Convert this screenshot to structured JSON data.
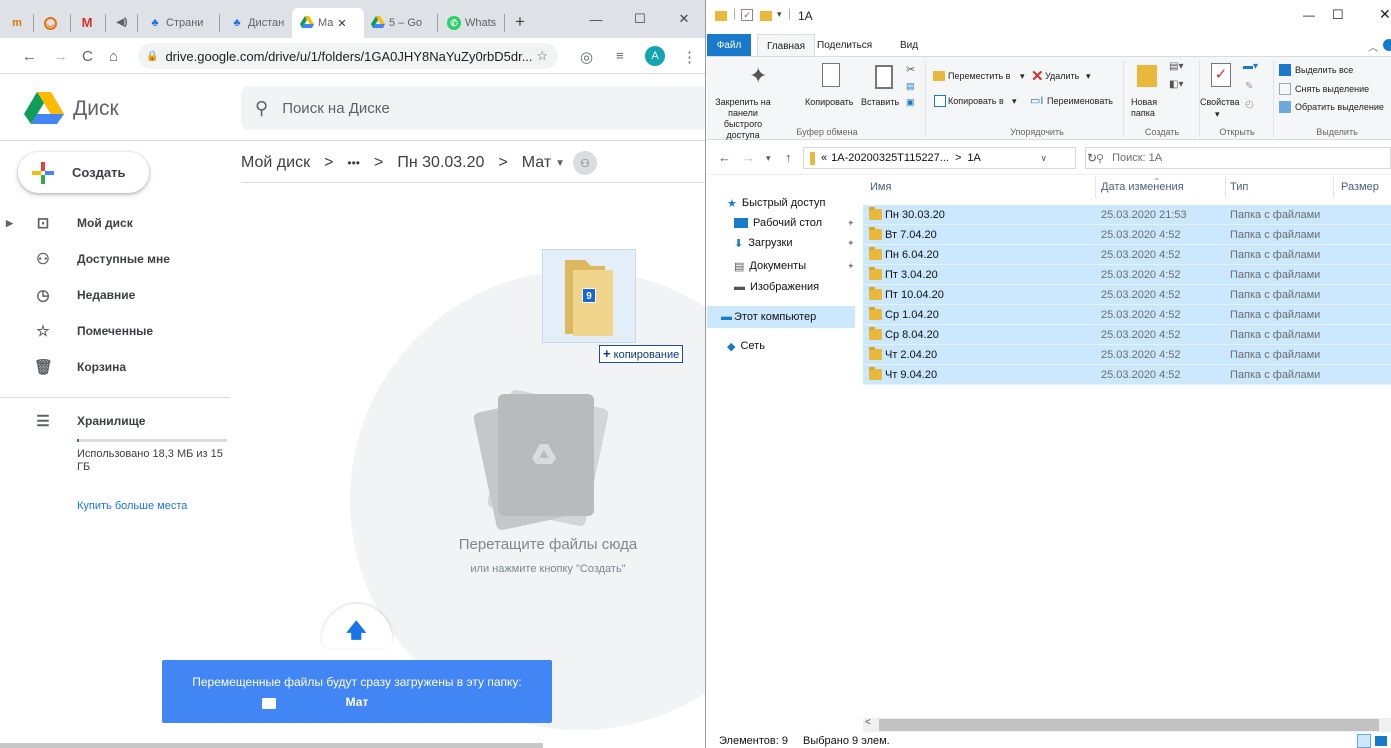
{
  "chrome": {
    "tabs": [
      {
        "label": "",
        "icon": "tm-logo-icon"
      },
      {
        "label": "",
        "icon": "mail-ru-icon"
      },
      {
        "label": "",
        "icon": "gmail-icon"
      },
      {
        "label": "",
        "icon": "speaker-icon"
      },
      {
        "label": "Страни",
        "icon": "contacts-icon"
      },
      {
        "label": "Дистан",
        "icon": "contacts-icon"
      },
      {
        "label": "Ма",
        "icon": "drive-icon",
        "active": true
      },
      {
        "label": "5 – Go",
        "icon": "drive-icon"
      },
      {
        "label": "Whats",
        "icon": "whatsapp-icon"
      }
    ],
    "url": "drive.google.com/drive/u/1/folders/1GA0JHY8NaYuZy0rbD5dr...",
    "profile_initial": "A"
  },
  "drive": {
    "title": "Диск",
    "search_placeholder": "Поиск на Диске",
    "create_label": "Создать",
    "nav": [
      {
        "label": "Мой диск",
        "icon": "my-drive-icon"
      },
      {
        "label": "Доступные мне",
        "icon": "shared-icon"
      },
      {
        "label": "Недавние",
        "icon": "clock-icon"
      },
      {
        "label": "Помеченные",
        "icon": "star-icon"
      },
      {
        "label": "Корзина",
        "icon": "trash-icon"
      }
    ],
    "storage_label": "Хранилище",
    "storage_used": "Использовано 18,3 МБ из 15 ГБ",
    "storage_fraction": 0.0012,
    "buy_more": "Купить больше места",
    "breadcrumb": {
      "root": "Мой диск",
      "sep": ">",
      "ellipsis": "•••",
      "folder1": "Пн 30.03.20",
      "current": "Мат"
    },
    "drop_title": "Перетащите файлы сюда",
    "drop_subtitle": "или нажмите кнопку \"Создать\"",
    "banner_text": "Перемещенные файлы будут сразу загружены в эту папку:",
    "banner_folder": "Мат",
    "drag_count": "9",
    "drag_tooltip": "копирование"
  },
  "explorer": {
    "title": "1А",
    "ribbon_tabs": {
      "file": "Файл",
      "home": "Главная",
      "share": "Поделиться",
      "view": "Вид"
    },
    "ribbon": {
      "pin": "Закрепить на панели быстрого доступа",
      "copy": "Копировать",
      "paste": "Вставить",
      "clipboard_group": "Буфер обмена",
      "move_to": "Переместить в",
      "copy_to": "Копировать в",
      "delete": "Удалить",
      "rename": "Переименовать",
      "organize_group": "Упорядочить",
      "new_folder": "Новая папка",
      "create_group": "Создать",
      "properties": "Свойства",
      "open_group": "Открыть",
      "select_all": "Выделить все",
      "select_none": "Снять выделение",
      "invert_selection": "Обратить выделение",
      "select_group": "Выделить"
    },
    "path_parts": {
      "prefix": "«",
      "parent": "1А-20200325T115227...",
      "sep": ">",
      "current": "1А"
    },
    "search_placeholder": "Поиск: 1А",
    "nav": {
      "quick_access": "Быстрый доступ",
      "desktop": "Рабочий стол",
      "downloads": "Загрузки",
      "documents": "Документы",
      "images": "Изображения",
      "this_pc": "Этот компьютер",
      "network": "Сеть"
    },
    "columns": {
      "name": "Имя",
      "date": "Дата изменения",
      "type": "Тип",
      "size": "Размер"
    },
    "files": [
      {
        "name": "Пн 30.03.20",
        "date": "25.03.2020 21:53",
        "type": "Папка с файлами"
      },
      {
        "name": "Вт 7.04.20",
        "date": "25.03.2020 4:52",
        "type": "Папка с файлами"
      },
      {
        "name": "Пн 6.04.20",
        "date": "25.03.2020 4:52",
        "type": "Папка с файлами"
      },
      {
        "name": "Пт 3.04.20",
        "date": "25.03.2020 4:52",
        "type": "Папка с файлами"
      },
      {
        "name": "Пт 10.04.20",
        "date": "25.03.2020 4:52",
        "type": "Папка с файлами"
      },
      {
        "name": "Ср 1.04.20",
        "date": "25.03.2020 4:52",
        "type": "Папка с файлами"
      },
      {
        "name": "Ср 8.04.20",
        "date": "25.03.2020 4:52",
        "type": "Папка с файлами"
      },
      {
        "name": "Чт 2.04.20",
        "date": "25.03.2020 4:52",
        "type": "Папка с файлами"
      },
      {
        "name": "Чт 9.04.20",
        "date": "25.03.2020 4:52",
        "type": "Папка с файлами"
      }
    ],
    "status_items": "Элементов: 9",
    "status_selected": "Выбрано 9 элем."
  }
}
